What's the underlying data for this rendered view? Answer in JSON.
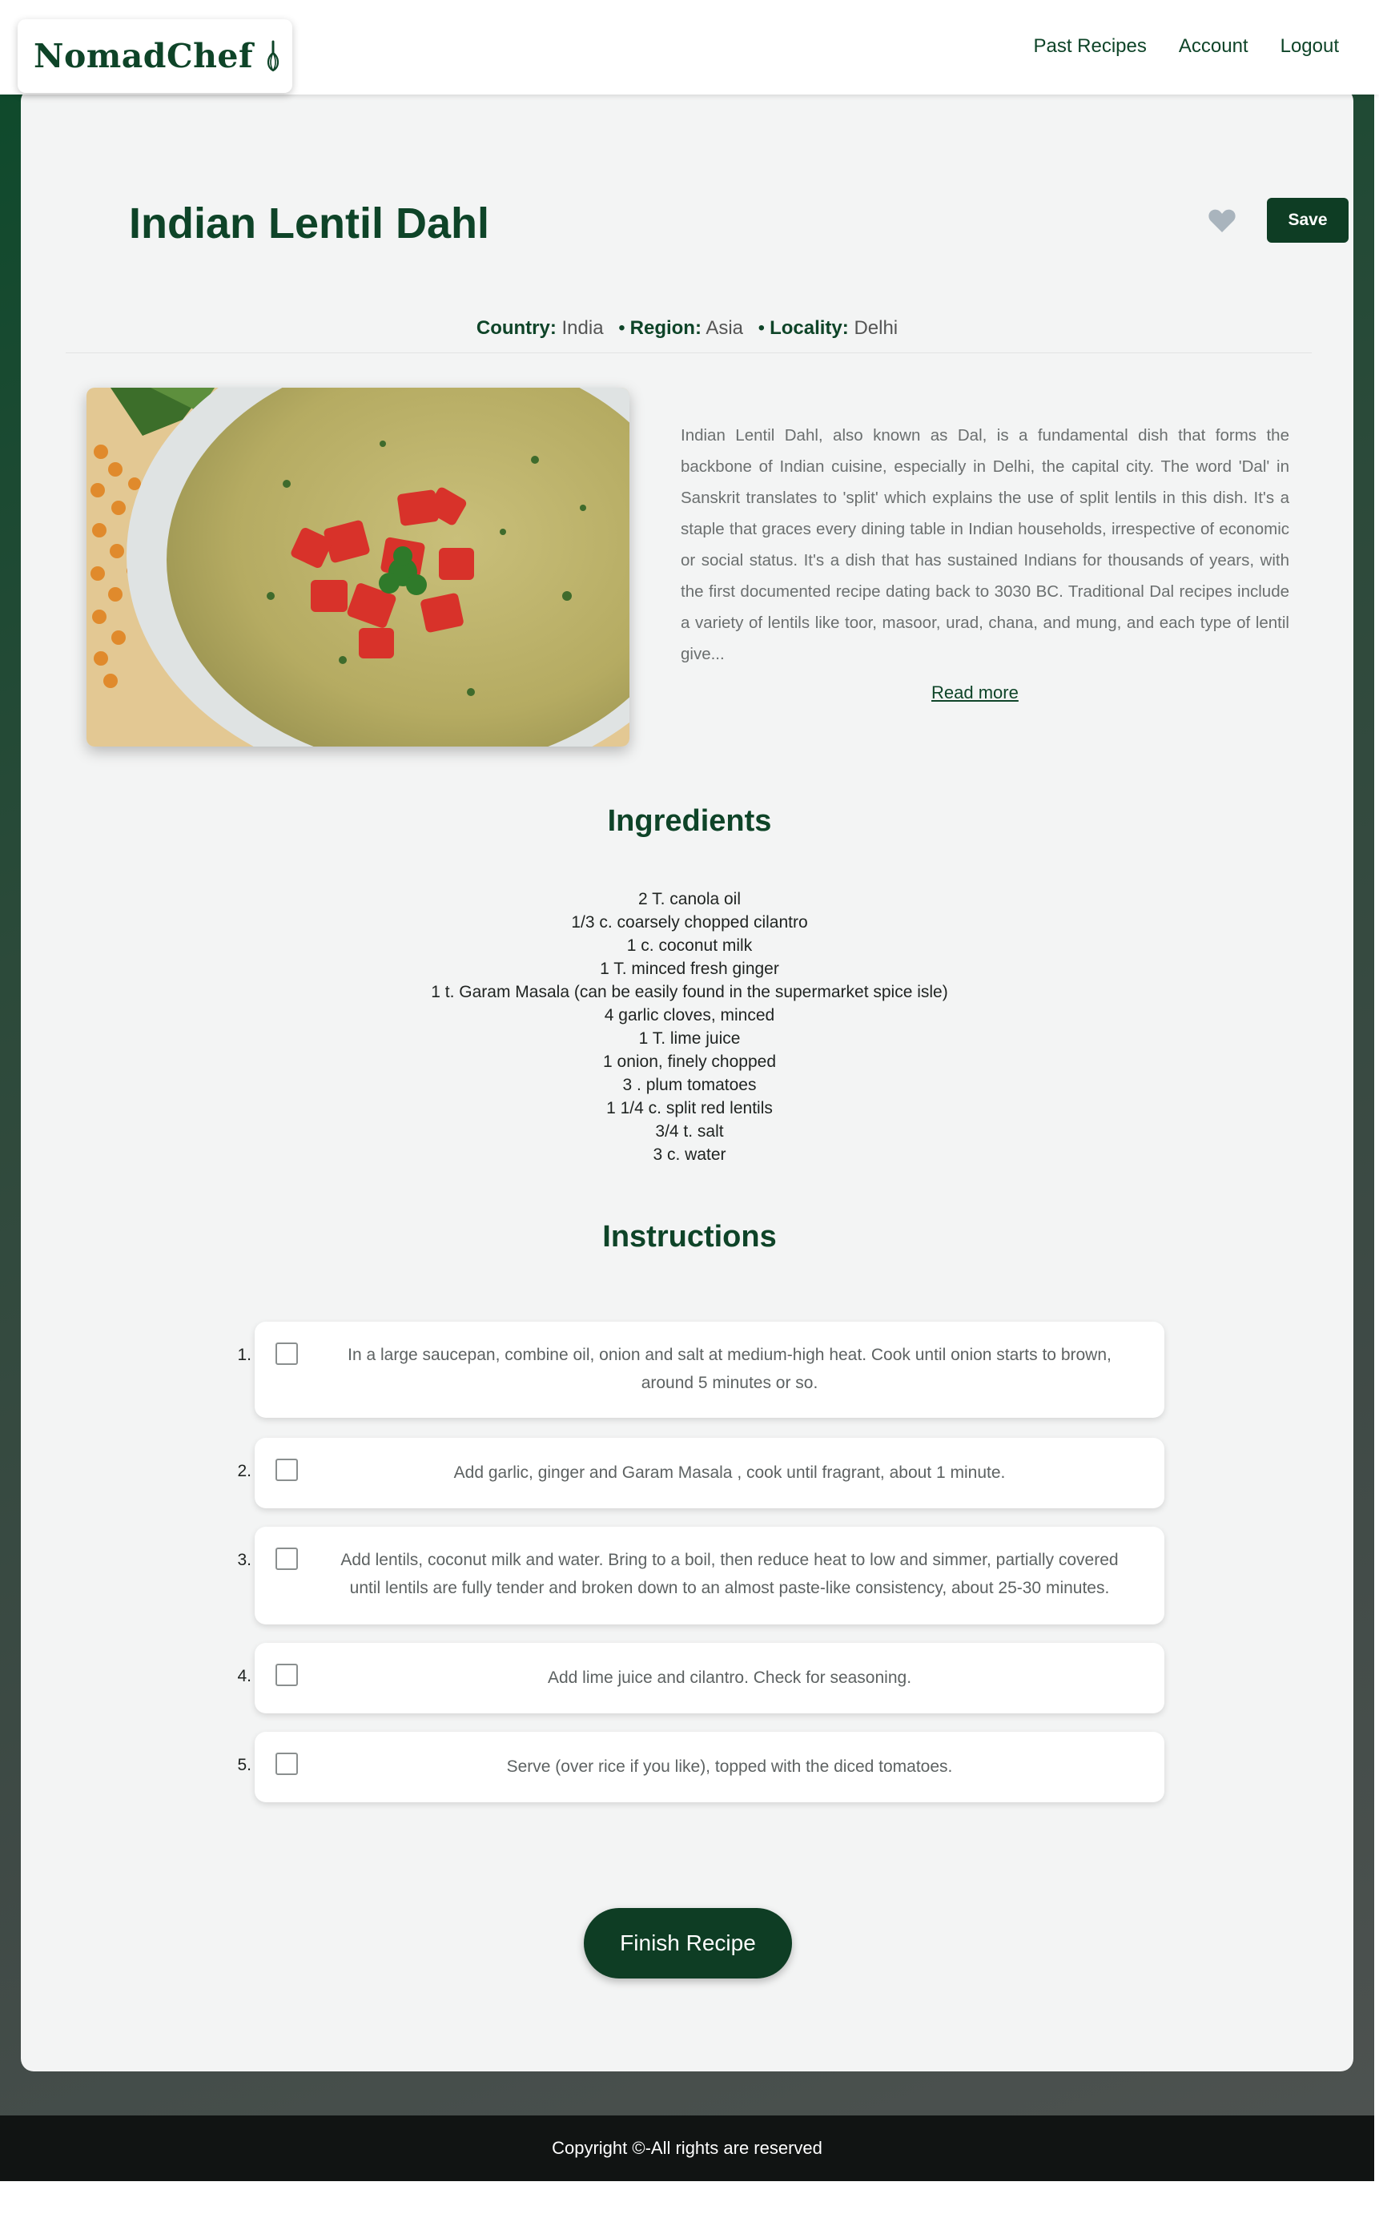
{
  "header": {
    "logo_text": "NomadChef",
    "nav": [
      "Past Recipes",
      "Account",
      "Logout"
    ]
  },
  "recipe": {
    "title": "Indian Lentil Dahl",
    "save_label": "Save",
    "country_label": "Country:",
    "country": "India",
    "region_label": "Region:",
    "region": "Asia",
    "locality_label": "Locality:",
    "locality": "Delhi",
    "description": "Indian Lentil Dahl, also known as Dal, is a fundamental dish that forms the backbone of Indian cuisine, especially in Delhi, the capital city. The word 'Dal' in Sanskrit translates to 'split' which explains the use of split lentils in this dish. It's a staple that graces every dining table in Indian households, irrespective of economic or social status. It's a dish that has sustained Indians for thousands of years, with the first documented recipe dating back to 3030 BC. Traditional Dal recipes include a variety of lentils like toor, masoor, urad, chana, and mung, and each type of lentil give...",
    "read_more": "Read more"
  },
  "ingredients": {
    "title": "Ingredients",
    "items": [
      "2 T. canola oil",
      "1/3 c. coarsely chopped cilantro",
      "1 c. coconut milk",
      "1 T. minced fresh ginger",
      "1 t. Garam Masala (can be easily found in the supermarket spice isle)",
      "4 garlic cloves, minced",
      "1 T. lime juice",
      "1 onion, finely chopped",
      "3 . plum tomatoes",
      "1 1/4 c. split red lentils",
      "3/4 t. salt",
      "3 c. water"
    ]
  },
  "instructions": {
    "title": "Instructions",
    "steps": [
      {
        "num": "1.",
        "text": "In a large saucepan, combine oil, onion and salt at medium-high heat. Cook until onion starts to brown, around 5 minutes or so.",
        "checked": false
      },
      {
        "num": "2.",
        "text": "Add garlic, ginger and Garam Masala , cook until fragrant, about 1 minute.",
        "checked": false
      },
      {
        "num": "3.",
        "text": "Add lentils, coconut milk and water. Bring to a boil, then reduce heat to low and simmer, partially covered until lentils are fully tender and broken down to an almost paste-like consistency, about 25-30 minutes.",
        "checked": false
      },
      {
        "num": "4.",
        "text": "Add lime juice and cilantro. Check for seasoning.",
        "checked": false
      },
      {
        "num": "5.",
        "text": "Serve (over rice if you like), topped with the diced tomatoes.",
        "checked": false
      }
    ],
    "finish_label": "Finish Recipe"
  },
  "footer": {
    "copyright": "Copyright ©-All rights are reserved"
  },
  "colors": {
    "brand": "#0e4428",
    "button": "#0e3d24",
    "card": "#f3f4f4",
    "footer": "#111413"
  }
}
